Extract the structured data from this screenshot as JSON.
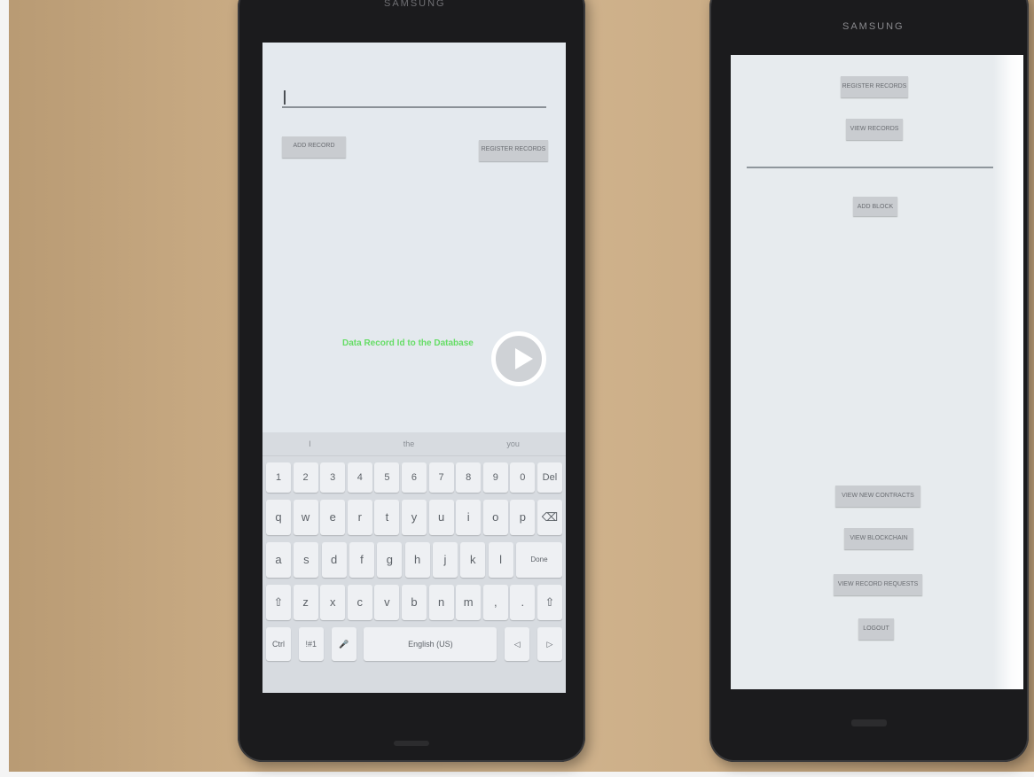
{
  "left_phone": {
    "brand": "SAMSUNG",
    "input_value": "|",
    "buttons": {
      "add": "ADD RECORD",
      "register": "REGISTER RECORDS"
    },
    "toast": "Data Record Id to the Database",
    "keyboard": {
      "suggestions": [
        "I",
        "the",
        "you"
      ],
      "number_row": [
        "1",
        "2",
        "3",
        "4",
        "5",
        "6",
        "7",
        "8",
        "9",
        "0",
        "Del"
      ],
      "row_qwerty": [
        "q",
        "w",
        "e",
        "r",
        "t",
        "y",
        "u",
        "i",
        "o",
        "p",
        "⌫"
      ],
      "row_asdf": [
        "a",
        "s",
        "d",
        "f",
        "g",
        "h",
        "j",
        "k",
        "l",
        "Done"
      ],
      "row_zxcv": [
        "⇧",
        "z",
        "x",
        "c",
        "v",
        "b",
        "n",
        "m",
        ",",
        ".",
        "⇧"
      ],
      "bottom_row": [
        "Ctrl",
        "!#1",
        "🎤",
        "English (US)",
        "◁",
        "▷"
      ]
    }
  },
  "right_phone": {
    "brand": "SAMSUNG",
    "buttons": {
      "register": "REGISTER RECORDS",
      "view": "VIEW RECORDS",
      "add_block": "ADD BLOCK",
      "view_new_contracts": "VIEW NEW CONTRACTS",
      "view_blockchain": "VIEW BLOCKCHAIN",
      "view_record_requests": "VIEW RECORD REQUESTS",
      "logout": "LOGOUT"
    }
  },
  "video": {
    "play_icon": "play-icon"
  }
}
